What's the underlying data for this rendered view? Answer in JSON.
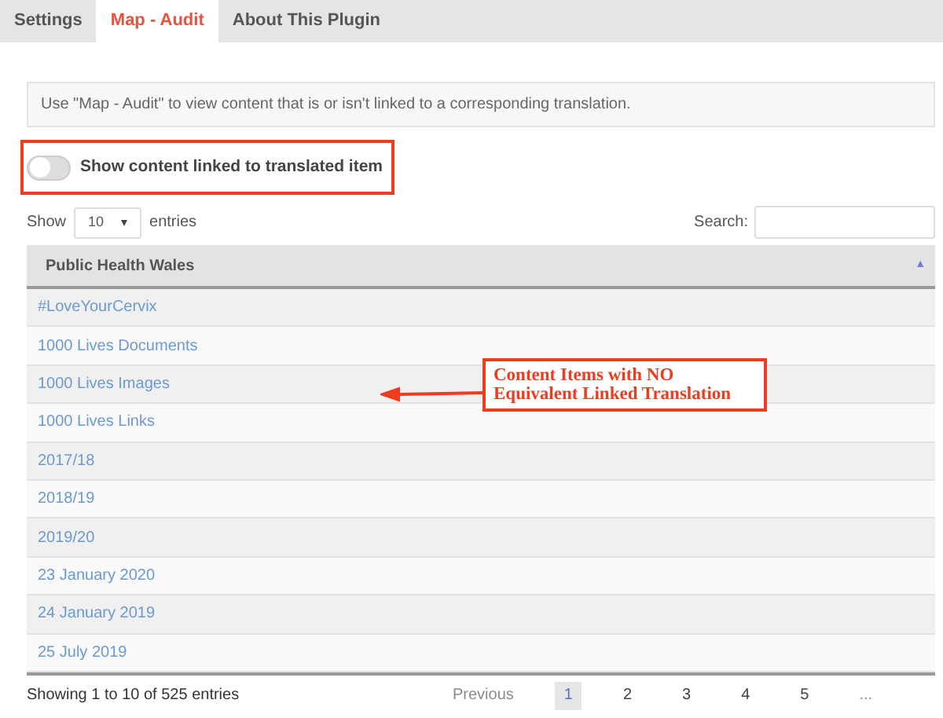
{
  "tabs": [
    {
      "label": "Settings",
      "selected": false
    },
    {
      "label": "Map - Audit",
      "selected": true
    },
    {
      "label": "About This Plugin",
      "selected": false
    }
  ],
  "info": "Use \"Map - Audit\" to view content that is or isn't linked to a corresponding translation.",
  "toggle": {
    "label": "Show content linked to translated item",
    "on": false
  },
  "length": {
    "before": "Show",
    "value": "10",
    "after": "entries"
  },
  "search": {
    "label": "Search:"
  },
  "table": {
    "columns": [
      {
        "label": "Public Health Wales",
        "sort": "▲"
      }
    ],
    "rows": [
      "#LoveYourCervix",
      "1000 Lives Documents",
      "1000 Lives Images",
      "1000 Lives Links",
      "2017/18",
      "2018/19",
      "2019/20",
      "23 January 2020",
      "24 January 2019",
      "25 July 2019"
    ]
  },
  "info_footer": "Showing 1 to 10 of 525 entries",
  "pagination": [
    {
      "label": "Previous",
      "disabled": true,
      "selected": false
    },
    {
      "label": "1",
      "disabled": false,
      "selected": true
    },
    {
      "label": "2",
      "disabled": false,
      "selected": false
    },
    {
      "label": "3",
      "disabled": false,
      "selected": false
    },
    {
      "label": "4",
      "disabled": false,
      "selected": false
    },
    {
      "label": "5",
      "disabled": false,
      "selected": false
    },
    {
      "label": "...",
      "disabled": true,
      "selected": false
    }
  ],
  "annotation": {
    "lines": [
      "Content Items with NO",
      "Equivalent Linked Translation"
    ]
  }
}
